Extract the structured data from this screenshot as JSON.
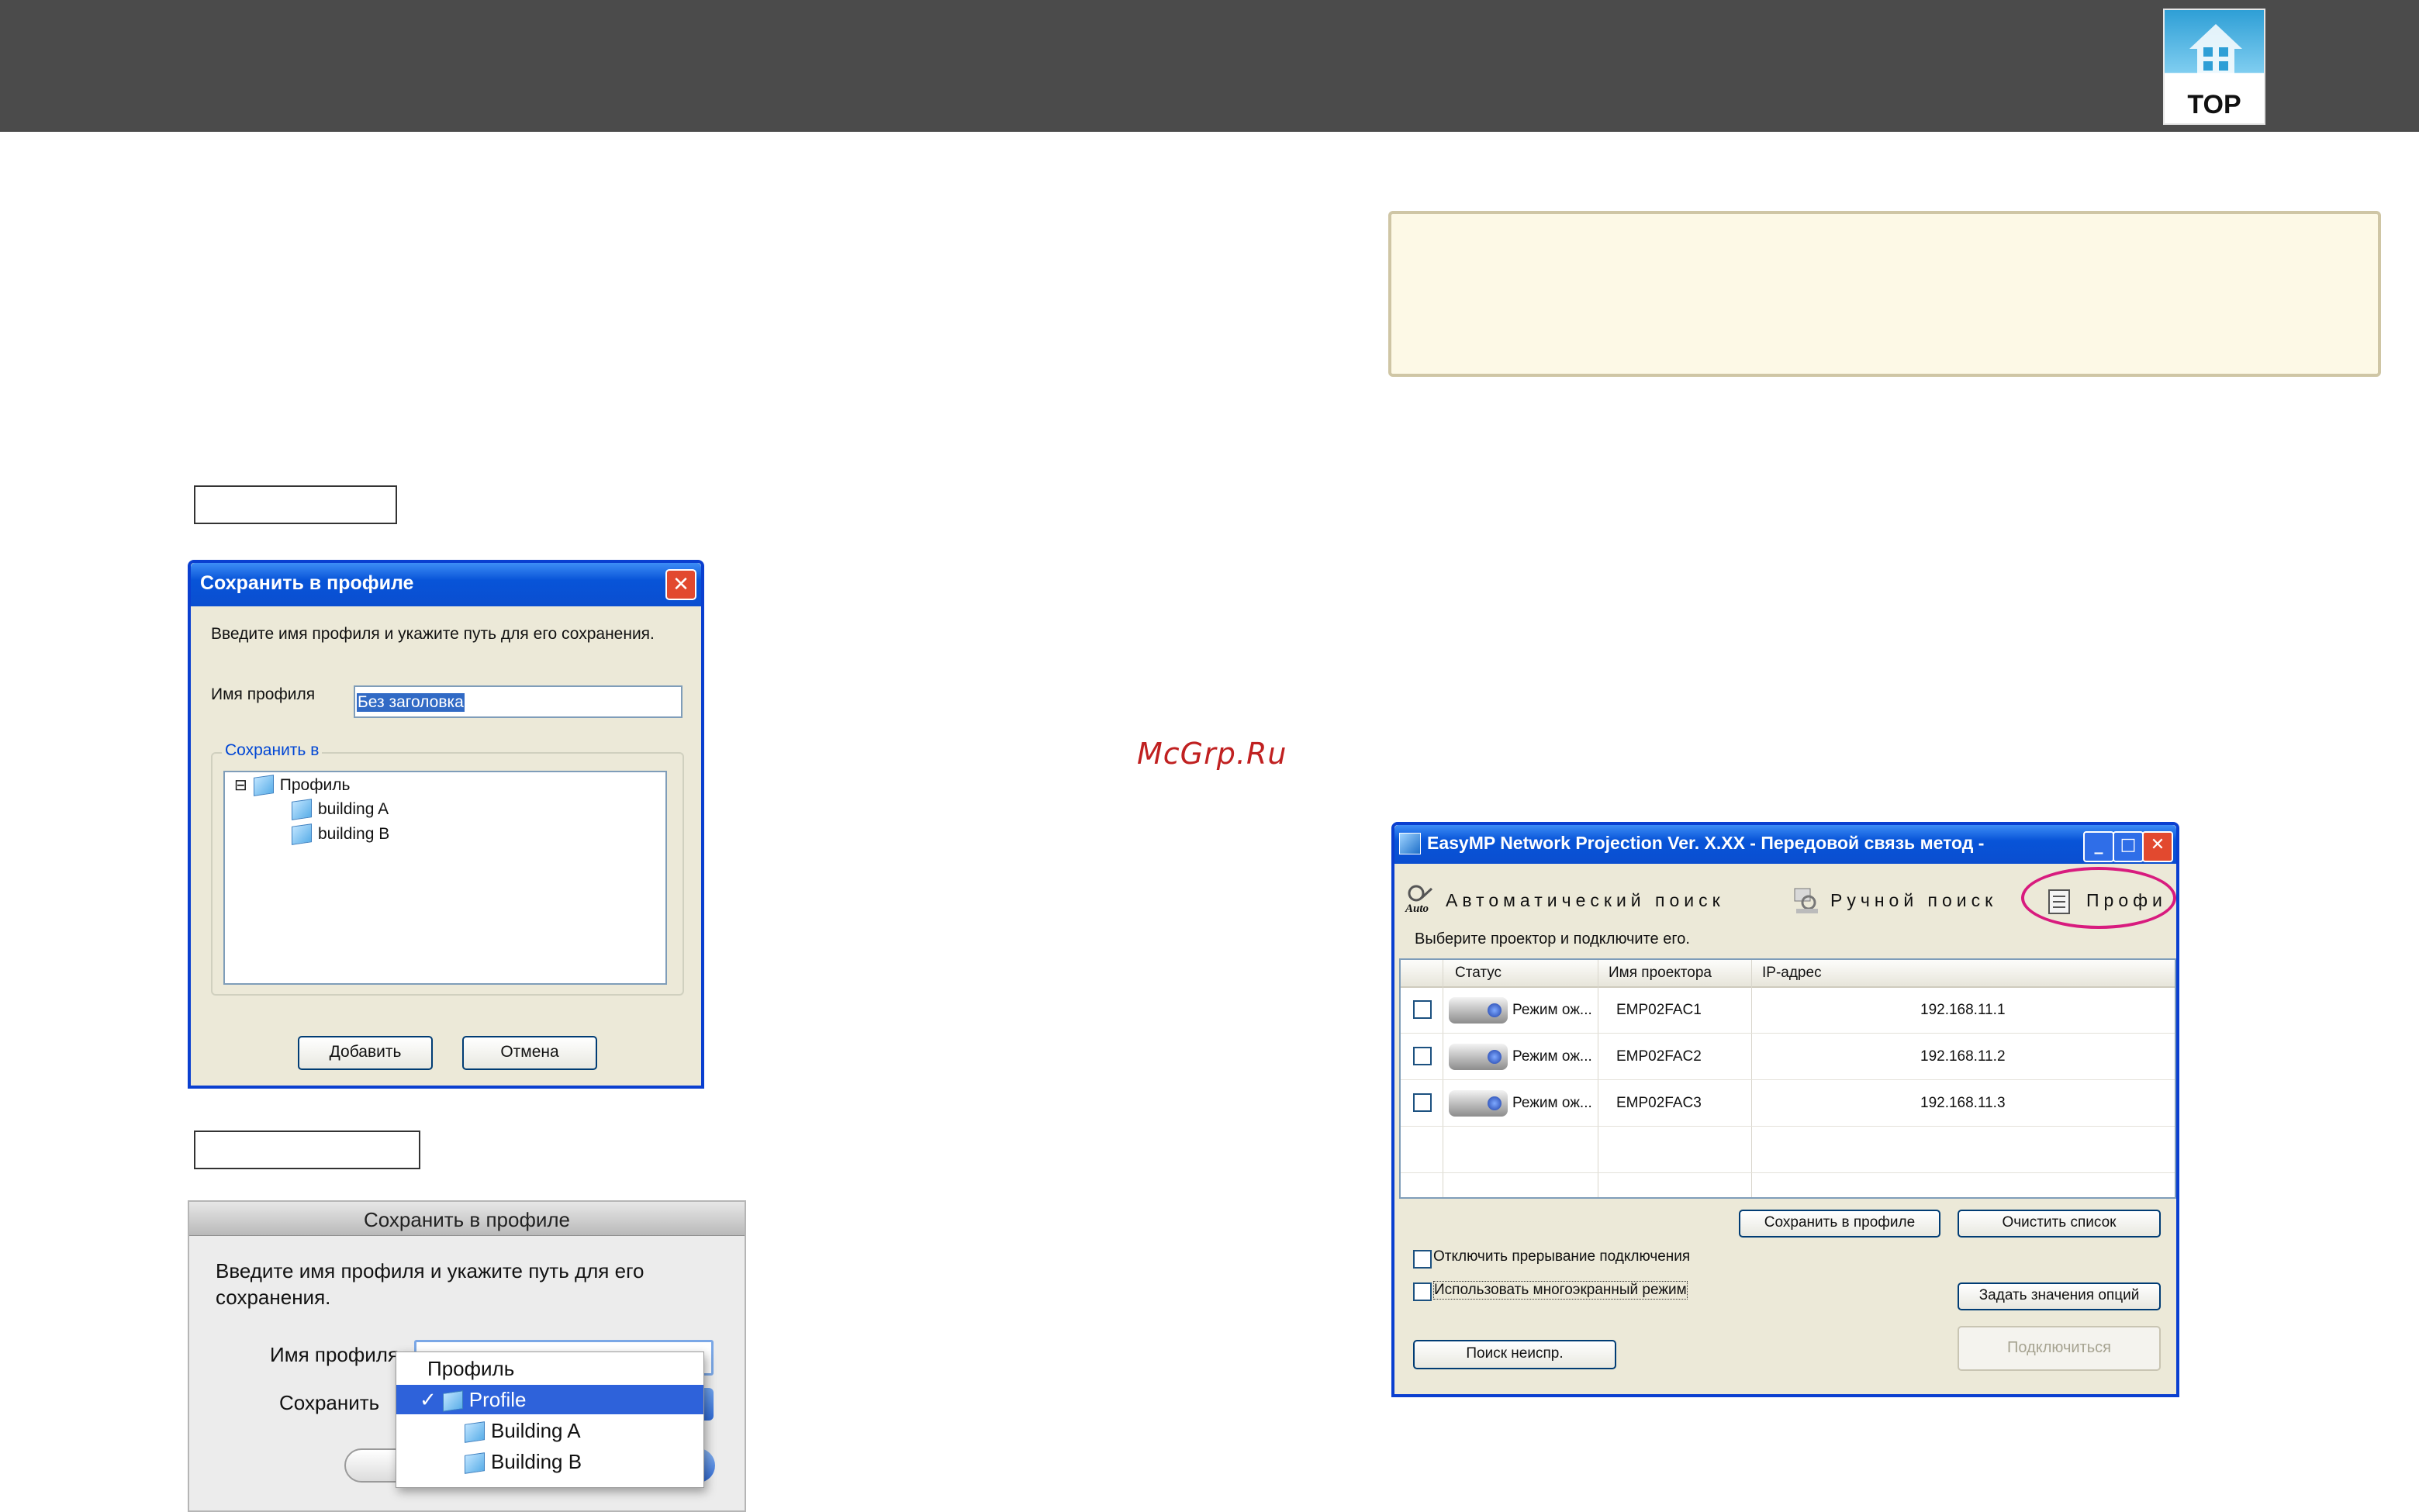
{
  "header": {
    "logo_label": "TOP"
  },
  "watermark": "McGrp.Ru",
  "windows_dialog": {
    "title": "Сохранить в профиле",
    "close_glyph": "✕",
    "instruction": "Введите имя профиля и укажите путь для его сохранения.",
    "profile_name_label": "Имя профиля",
    "profile_name_value": "Без заголовка",
    "save_in_label": "Сохранить в",
    "tree": {
      "expander": "⊟",
      "root": "Профиль",
      "children": [
        "building A",
        "building B"
      ]
    },
    "add_button": "Добавить",
    "cancel_button": "Отмена"
  },
  "mac_dialog": {
    "title": "Сохранить в профиле",
    "instruction_line1": "Введите имя профиля и укажите путь для его",
    "instruction_line2": "сохранения.",
    "profile_name_label": "Имя профиля",
    "save_label": "Сохранить",
    "menu": {
      "header": "Профиль",
      "check": "✓",
      "items": [
        "Profile",
        "Building A",
        "Building B"
      ],
      "selected": "Profile"
    }
  },
  "easymp": {
    "title": "EasyMP Network Projection Ver. X.XX - Передовой связь метод -",
    "minimize_glyph": "_",
    "maximize_glyph": "□",
    "close_glyph": "✕",
    "auto_icon_label": "Auto",
    "toolbar": [
      "Автоматический поиск",
      "Ручной поиск",
      "Профи"
    ],
    "prompt": "Выберите проектор и подключите его.",
    "columns": [
      "Статус",
      "Имя проектора",
      "IP-адрес"
    ],
    "rows": [
      {
        "status": "Режим ож...",
        "name": "EMP02FAC1",
        "ip": "192.168.11.1"
      },
      {
        "status": "Режим ож...",
        "name": "EMP02FAC2",
        "ip": "192.168.11.2"
      },
      {
        "status": "Режим ож...",
        "name": "EMP02FAC3",
        "ip": "192.168.11.3"
      }
    ],
    "save_profile_button": "Сохранить в профиле",
    "clear_list_button": "Очистить список",
    "disable_interrupt_label": "Отключить прерывание подключения",
    "multiscreen_label": "Использовать многоэкранный режим",
    "options_button": "Задать значения опций",
    "search_button": "Поиск неиспр.",
    "connect_button": "Подключиться",
    "highlight_color": "#d81b7e"
  }
}
